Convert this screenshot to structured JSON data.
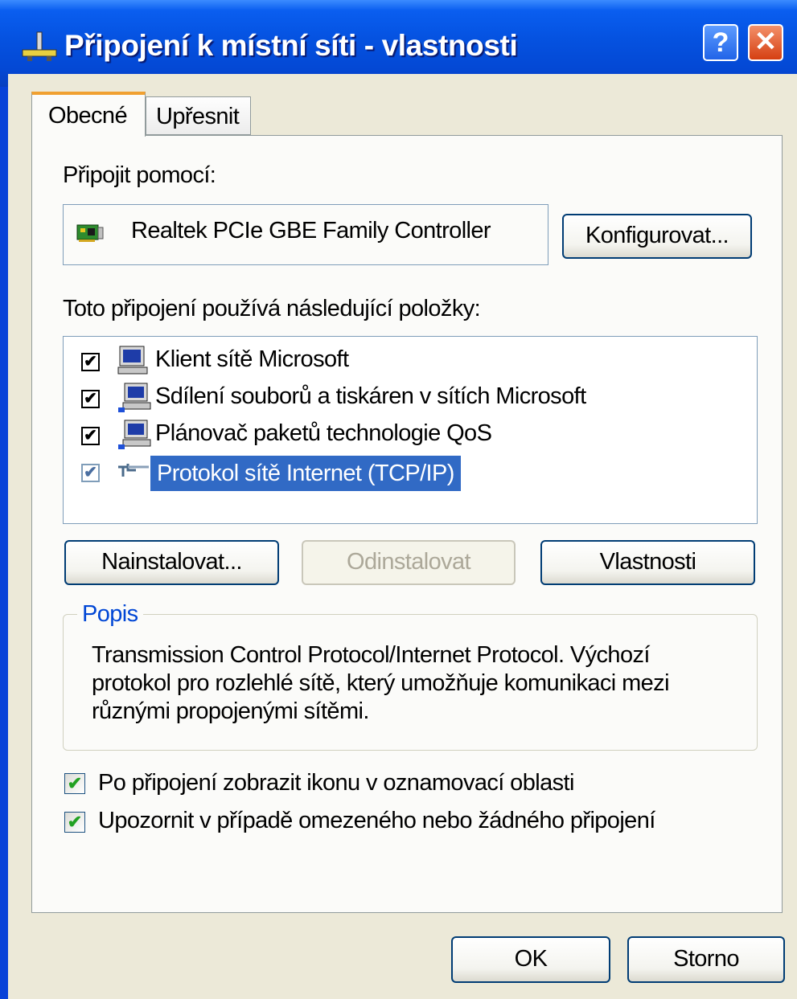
{
  "window": {
    "title": "Připojení k místní síti - vlastnosti",
    "help_glyph": "?",
    "close_glyph": "✕"
  },
  "tabs": [
    {
      "label": "Obecné"
    },
    {
      "label": "Upřesnit"
    }
  ],
  "connect_using": {
    "label": "Připojit pomocí:",
    "adapter": "Realtek PCIe GBE Family Controller",
    "adapter_icon": "network-adapter-icon",
    "configure_label": "Konfigurovat..."
  },
  "items": {
    "label": "Toto připojení používá následující položky:",
    "list": [
      {
        "label": "Klient sítě Microsoft",
        "checked": true,
        "icon": "network-client-icon",
        "selected": false
      },
      {
        "label": "Sdílení souborů a tiskáren v sítích Microsoft",
        "checked": true,
        "icon": "file-printer-sharing-icon",
        "selected": false
      },
      {
        "label": "Plánovač paketů technologie QoS",
        "checked": true,
        "icon": "qos-scheduler-icon",
        "selected": false
      },
      {
        "label": "Protokol sítě Internet (TCP/IP)",
        "checked": true,
        "icon": "protocol-icon",
        "selected": true
      }
    ],
    "check_glyph": "✔"
  },
  "buttons": {
    "install": "Nainstalovat...",
    "uninstall": "Odinstalovat",
    "properties": "Vlastnosti"
  },
  "description": {
    "title": "Popis",
    "lines": [
      "Transmission Control Protocol/Internet Protocol. Výchozí",
      "protokol pro rozlehlé sítě, který umožňuje komunikaci mezi",
      "různými propojenými sítěmi."
    ]
  },
  "options": [
    {
      "label": "Po připojení zobrazit ikonu v oznamovací oblasti",
      "checked": true
    },
    {
      "label": "Upozornit v případě omezeného nebo žádného připojení",
      "checked": true
    }
  ],
  "footer": {
    "ok": "OK",
    "cancel": "Storno"
  },
  "colors": {
    "titlebar": "#0552e0",
    "selection": "#316ac5",
    "group_title": "#0046d5",
    "checkmark_green": "#21a121"
  }
}
